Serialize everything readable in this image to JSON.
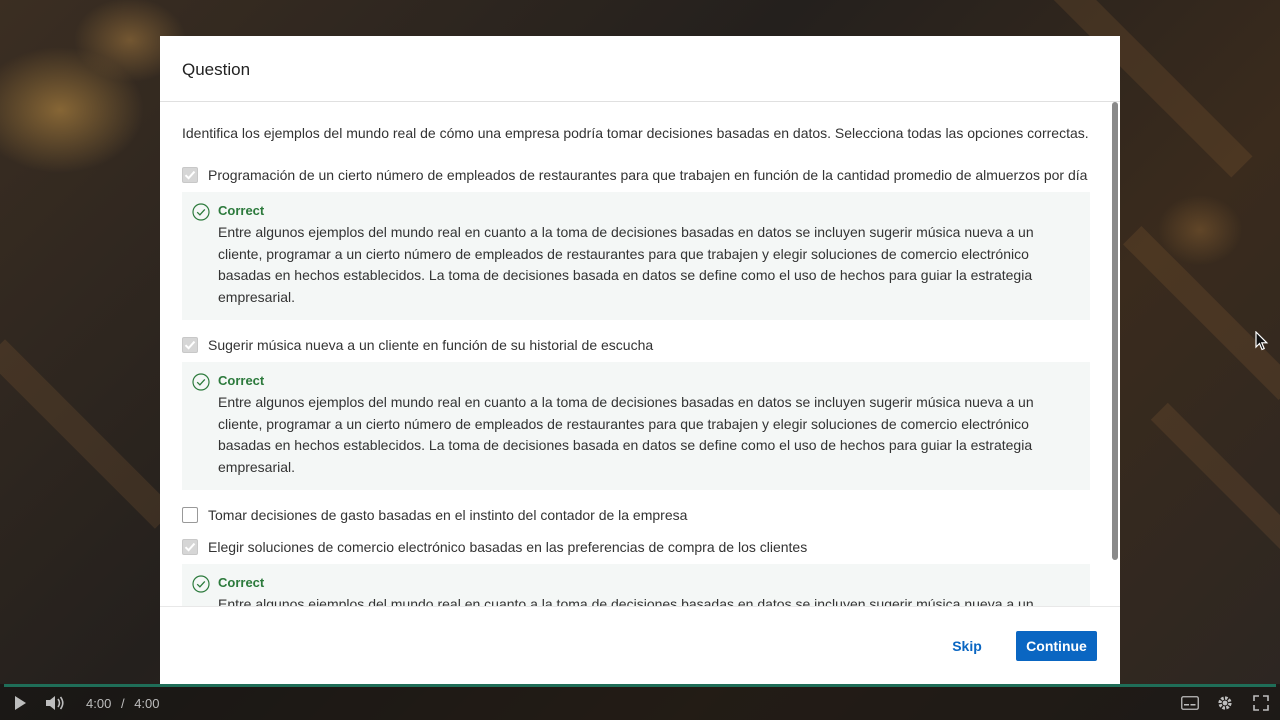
{
  "modal": {
    "title": "Question",
    "prompt": "Identifica los ejemplos del mundo real de cómo una empresa podría tomar decisiones basadas en datos. Selecciona todas las opciones correctas.",
    "options": [
      {
        "label": "Programación de un cierto número de empleados de restaurantes para que trabajen en función de la cantidad promedio de almuerzos por día",
        "checked": true,
        "feedback_title": "Correct",
        "feedback_text": "Entre algunos ejemplos del mundo real en cuanto a la toma de decisiones basadas en datos se incluyen sugerir música nueva a un cliente, programar a un cierto número de empleados de restaurantes para que trabajen y elegir soluciones de comercio electrónico basadas en hechos establecidos. La toma de decisiones basada en datos se define como el uso de hechos para guiar la estrategia empresarial."
      },
      {
        "label": "Sugerir música nueva a un cliente en función de su historial de escucha",
        "checked": true,
        "feedback_title": "Correct",
        "feedback_text": "Entre algunos ejemplos del mundo real en cuanto a la toma de decisiones basadas en datos se incluyen sugerir música nueva a un cliente, programar a un cierto número de empleados de restaurantes para que trabajen y elegir soluciones de comercio electrónico basadas en hechos establecidos. La toma de decisiones basada en datos se define como el uso de hechos para guiar la estrategia empresarial."
      },
      {
        "label": "Tomar decisiones de gasto basadas en el instinto del contador de la empresa",
        "checked": false
      },
      {
        "label": "Elegir soluciones de comercio electrónico basadas en las preferencias de compra de los clientes",
        "checked": true,
        "feedback_title": "Correct",
        "feedback_text": "Entre algunos ejemplos del mundo real en cuanto a la toma de decisiones basadas en datos se incluyen sugerir música nueva a un cliente, programar a un cierto número de empleados de restaurantes para que trabajen y elegir soluciones de comercio electrónico basadas en hechos"
      }
    ],
    "skip_label": "Skip",
    "continue_label": "Continue"
  },
  "player": {
    "current_time": "4:00",
    "separator": "/",
    "duration": "4:00",
    "progress": 1.0
  },
  "colors": {
    "accent": "#0a66c2",
    "correct": "#2c7a3c",
    "feedback_bg": "#f4f7f6"
  }
}
